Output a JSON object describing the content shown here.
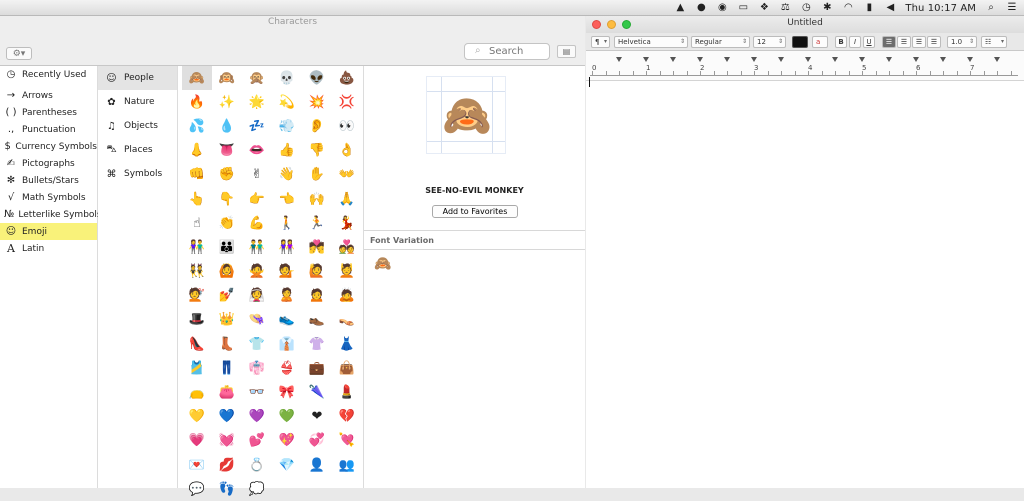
{
  "menubar": {
    "clock": "Thu 10:17 AM",
    "icons": [
      "drive-icon",
      "creative-cloud-icon",
      "sync-icon",
      "display-icon",
      "dropbox-icon",
      "scale-icon",
      "clock-icon",
      "bluetooth-icon",
      "wifi-icon",
      "battery-icon",
      "volume-icon",
      "search-icon",
      "list-icon"
    ]
  },
  "characters": {
    "window_title": "Characters",
    "search_placeholder": "Search",
    "categories": [
      {
        "label": "Recently Used",
        "icon": "clock-icon"
      },
      {
        "label": "Arrows",
        "icon": "arrow-icon"
      },
      {
        "label": "Parentheses",
        "icon": "parentheses-icon"
      },
      {
        "label": "Punctuation",
        "icon": "punctuation-icon"
      },
      {
        "label": "Currency Symbols",
        "icon": "dollar-icon"
      },
      {
        "label": "Pictographs",
        "icon": "pictograph-icon"
      },
      {
        "label": "Bullets/Stars",
        "icon": "star-icon"
      },
      {
        "label": "Math Symbols",
        "icon": "sqrt-icon"
      },
      {
        "label": "Letterlike Symbols",
        "icon": "numero-icon"
      },
      {
        "label": "Emoji",
        "icon": "smiley-icon"
      },
      {
        "label": "Latin",
        "icon": "latin-a-icon"
      }
    ],
    "subcategories": [
      {
        "label": "People",
        "icon": "smiley-icon"
      },
      {
        "label": "Nature",
        "icon": "flower-icon"
      },
      {
        "label": "Objects",
        "icon": "bell-icon"
      },
      {
        "label": "Places",
        "icon": "car-icon"
      },
      {
        "label": "Symbols",
        "icon": "symbols-icon"
      }
    ],
    "emoji": [
      "🙈",
      "🙉",
      "🙊",
      "💀",
      "👽",
      "💩",
      "🔥",
      "✨",
      "🌟",
      "💫",
      "💥",
      "💢",
      "💦",
      "💧",
      "💤",
      "💨",
      "👂",
      "👀",
      "👃",
      "👅",
      "👄",
      "👍",
      "👎",
      "👌",
      "👊",
      "✊",
      "✌",
      "👋",
      "✋",
      "👐",
      "👆",
      "👇",
      "👉",
      "👈",
      "🙌",
      "🙏",
      "☝",
      "👏",
      "💪",
      "🚶",
      "🏃",
      "💃",
      "👫",
      "👪",
      "👬",
      "👭",
      "💏",
      "💑",
      "👯",
      "🙆",
      "🙅",
      "💁",
      "🙋",
      "💆",
      "💇",
      "💅",
      "👰",
      "🙎",
      "🙍",
      "🙇",
      "🎩",
      "👑",
      "👒",
      "👟",
      "👞",
      "👡",
      "👠",
      "👢",
      "👕",
      "👔",
      "👚",
      "👗",
      "🎽",
      "👖",
      "👘",
      "👙",
      "💼",
      "👜",
      "👝",
      "👛",
      "👓",
      "🎀",
      "🌂",
      "💄",
      "💛",
      "💙",
      "💜",
      "💚",
      "❤",
      "💔",
      "💗",
      "💓",
      "💕",
      "💖",
      "💞",
      "💘",
      "💌",
      "💋",
      "💍",
      "💎",
      "👤",
      "👥",
      "💬",
      "👣",
      "💭"
    ],
    "selected_name": "SEE-NO-EVIL MONKEY",
    "selected_char": "🙈",
    "add_favorites_label": "Add to Favorites",
    "font_variation_label": "Font Variation",
    "variation_char": "🙈"
  },
  "textedit": {
    "title": "Untitled",
    "toolbar": {
      "paragraph": "¶",
      "font": "Helvetica",
      "style": "Regular",
      "size": "12",
      "bold": "B",
      "italic": "I",
      "underline": "U",
      "spacing": "1.0"
    },
    "ruler_numbers": [
      "0",
      "1",
      "2",
      "3",
      "4",
      "5",
      "6",
      "7"
    ]
  }
}
